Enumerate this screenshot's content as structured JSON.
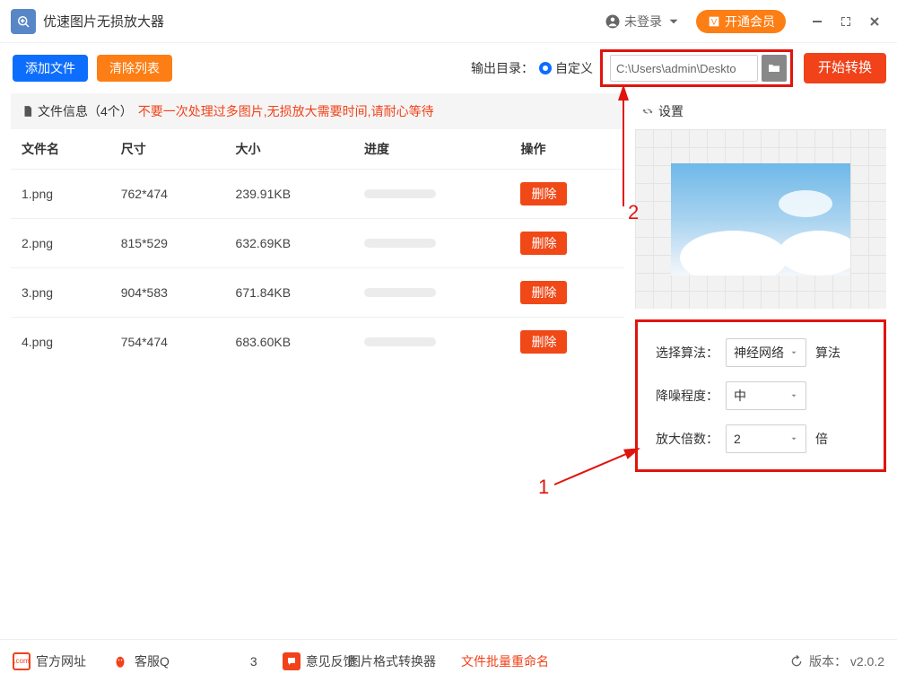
{
  "titlebar": {
    "app_title": "优速图片无损放大器",
    "user_label": "未登录",
    "vip_label": "开通会员"
  },
  "toolbar": {
    "add_files": "添加文件",
    "clear_list": "清除列表",
    "output_dir_label": "输出目录：",
    "custom_opt": "自定义",
    "output_path": "C:\\Users\\admin\\Deskto",
    "start_convert": "开始转换"
  },
  "file_header": {
    "label_fileinfo": "文件信息（4个）",
    "warning": "不要一次处理过多图片,无损放大需要时间,请耐心等待"
  },
  "columns": {
    "filename": "文件名",
    "size": "尺寸",
    "filesize": "大小",
    "progress": "进度",
    "ops": "操作"
  },
  "files": [
    {
      "name": "1.png",
      "dim": "762*474",
      "size": "239.91KB"
    },
    {
      "name": "2.png",
      "dim": "815*529",
      "size": "632.69KB"
    },
    {
      "name": "3.png",
      "dim": "904*583",
      "size": "671.84KB"
    },
    {
      "name": "4.png",
      "dim": "754*474",
      "size": "683.60KB"
    }
  ],
  "delete_label": "删除",
  "settings": {
    "header": "设置",
    "algorithm_label": "选择算法：",
    "algorithm_value": "神经网络",
    "algorithm_suffix": "算法",
    "denoise_label": "降噪程度：",
    "denoise_value": "中",
    "scale_label": "放大倍数：",
    "scale_value": "2",
    "scale_suffix": "倍"
  },
  "footer": {
    "site": "官方网址",
    "qq": "客服Q",
    "qqnum": "3",
    "feedback": "意见反馈",
    "link1": "图片格式转换器",
    "link2": "文件批量重命名",
    "version": "版本： v2.0.2",
    "refresh_ic": "⟳"
  },
  "annotations": {
    "n1": "1",
    "n2": "2"
  }
}
